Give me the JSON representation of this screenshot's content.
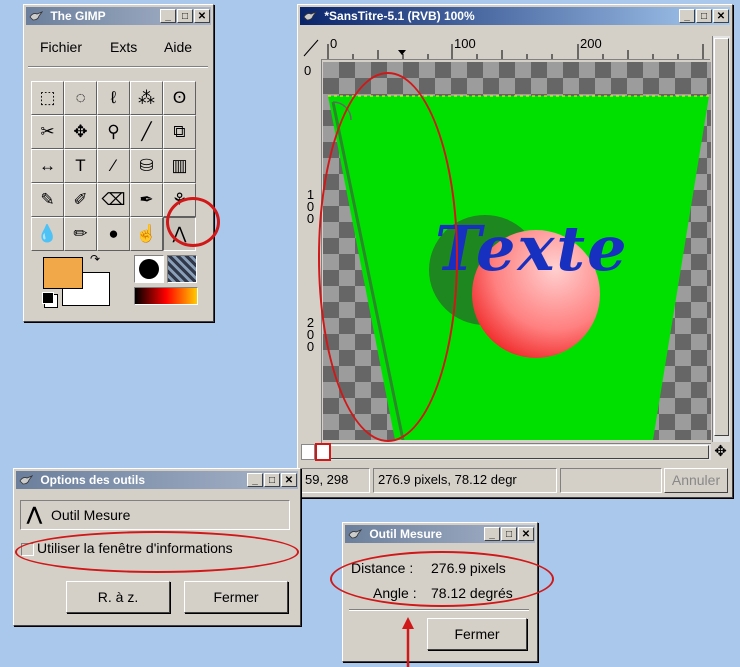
{
  "toolbox": {
    "title": "The GIMP",
    "menu": [
      "Fichier",
      "Exts",
      "Aide"
    ],
    "tools": [
      {
        "name": "rect-select-tool",
        "glyph": "⬚"
      },
      {
        "name": "ellipse-select-tool",
        "glyph": "◌"
      },
      {
        "name": "lasso-select-tool",
        "glyph": "ℓ"
      },
      {
        "name": "fuzzy-select-tool",
        "glyph": "⁂"
      },
      {
        "name": "bezier-select-tool",
        "glyph": "ʘ"
      },
      {
        "name": "iscissors-tool",
        "glyph": "✂"
      },
      {
        "name": "move-tool",
        "glyph": "✥"
      },
      {
        "name": "magnify-tool",
        "glyph": "⚲"
      },
      {
        "name": "crop-tool",
        "glyph": "╱"
      },
      {
        "name": "transform-tool",
        "glyph": "⧉"
      },
      {
        "name": "flip-tool",
        "glyph": "↔"
      },
      {
        "name": "text-tool",
        "glyph": "T"
      },
      {
        "name": "color-picker-tool",
        "glyph": "⁄"
      },
      {
        "name": "bucket-fill-tool",
        "glyph": "⛁"
      },
      {
        "name": "blend-tool",
        "glyph": "▥"
      },
      {
        "name": "pencil-tool",
        "glyph": "✎"
      },
      {
        "name": "paintbrush-tool",
        "glyph": "✐"
      },
      {
        "name": "eraser-tool",
        "glyph": "⌫"
      },
      {
        "name": "airbrush-tool",
        "glyph": "✒"
      },
      {
        "name": "clone-tool",
        "glyph": "⚘"
      },
      {
        "name": "convolve-tool",
        "glyph": "💧"
      },
      {
        "name": "ink-tool",
        "glyph": "✏"
      },
      {
        "name": "dodge-burn-tool",
        "glyph": "●"
      },
      {
        "name": "smudge-tool",
        "glyph": "☝"
      },
      {
        "name": "measure-tool",
        "glyph": "⋀"
      }
    ],
    "fg_color": "#f0a848",
    "bg_color": "#ffffff"
  },
  "image_window": {
    "title": "*SansTitre-5.1 (RVB) 100%",
    "ruler_h_labels": [
      "0",
      "100",
      "200"
    ],
    "ruler_v_labels": [
      "0",
      "100",
      "200"
    ],
    "canvas_text": "Texte",
    "status_coords": "59, 298",
    "status_measure": "276.9 pixels, 78.12 degr",
    "cancel_label": "Annuler"
  },
  "options_window": {
    "title": "Options des outils",
    "tool_name": "Outil Mesure",
    "checkbox_label": "Utiliser la fenêtre d'informations",
    "checkbox_checked": false,
    "reset_label": "R. à z.",
    "close_label": "Fermer"
  },
  "measure_window": {
    "title": "Outil Mesure",
    "distance_label": "Distance :",
    "distance_value": "276.9 pixels",
    "angle_label": "Angle :",
    "angle_value": "78.12 degrés",
    "close_label": "Fermer"
  },
  "colors": {
    "green_layer": "#00e000",
    "text_blue": "#1830c0",
    "annotation_red": "#d01818"
  }
}
